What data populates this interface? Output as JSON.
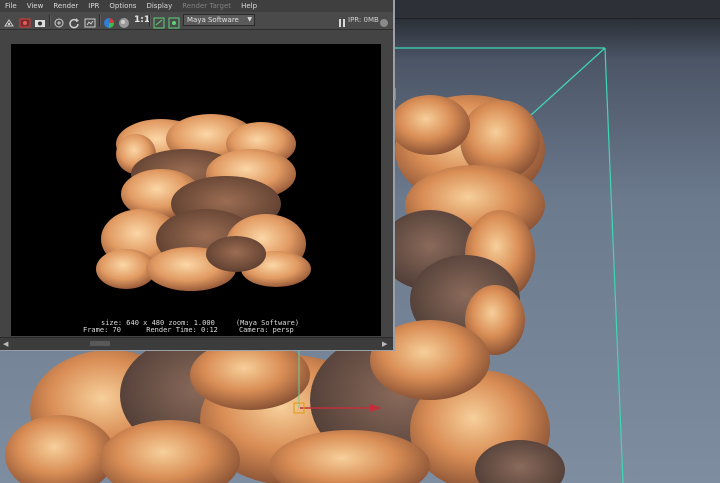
{
  "menu": {
    "file": "File",
    "view": "View",
    "render": "Render",
    "ipr": "IPR",
    "options": "Options",
    "display": "Display",
    "render_target": "Render Target",
    "help": "Help"
  },
  "toolbar": {
    "ratio_label": "1:1",
    "renderer": "Maya Software",
    "ipr_status": "IPR: 0MB"
  },
  "render_info": {
    "line1": "size: 640 x 480 zoom: 1.000     (Maya Software)",
    "frame": "Frame: 70",
    "render_time": "Render Time: 0:12",
    "camera": "Camera: persp"
  },
  "colors": {
    "bounding_box": "#3fd6b4",
    "smoke_light": "#f0b47c",
    "smoke_dark": "#5a3a2a",
    "manipulator_x": "#c0303a",
    "manipulator_y": "#6bd39a",
    "pivot": "#e0a020"
  }
}
